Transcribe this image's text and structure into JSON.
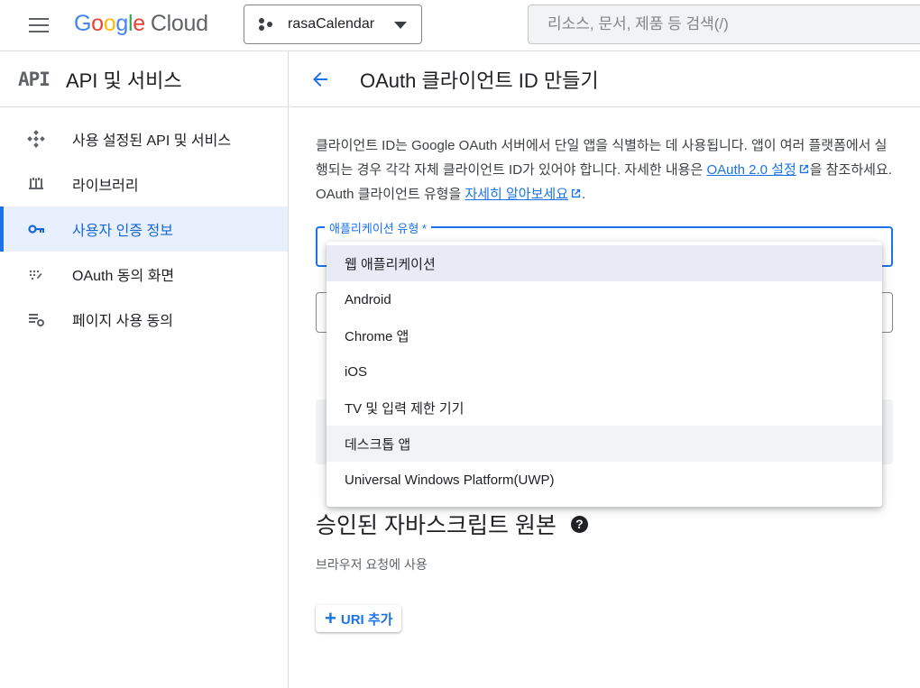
{
  "topbar": {
    "logo_google": [
      "G",
      "o",
      "o",
      "g",
      "l",
      "e"
    ],
    "logo_cloud": "Cloud",
    "project_name": "rasaCalendar",
    "search_placeholder": "리소스, 문서, 제품 등 검색(/)"
  },
  "sidebar": {
    "badge": "API",
    "title": "API 및 서비스",
    "items": [
      {
        "label": "사용 설정된 API 및 서비스",
        "icon": "enabled-apis-icon"
      },
      {
        "label": "라이브러리",
        "icon": "library-icon"
      },
      {
        "label": "사용자 인증 정보",
        "icon": "key-icon",
        "active": true
      },
      {
        "label": "OAuth 동의 화면",
        "icon": "consent-screen-icon"
      },
      {
        "label": "페이지 사용 동의",
        "icon": "page-usage-icon"
      }
    ]
  },
  "main": {
    "title": "OAuth 클라이언트 ID 만들기",
    "desc_part1": "클라이언트 ID는 Google OAuth 서버에서 단일 앱을 식별하는 데 사용됩니다. 앱이 여러 플랫폼에서 실행되는 경우 각각 자체 클라이언트 ID가 있어야 합니다. 자세한 내용은 ",
    "desc_link1": "OAuth 2.0 설정",
    "desc_part2": "을 참조하세요. OAuth 클라이언트 유형을 ",
    "desc_link2": "자세히 알아보세요",
    "desc_part3": ".",
    "app_type_label": "애플리케이션 유형 *",
    "section_title": "승인된 자바스크립트 원본",
    "section_sub": "브라우저 요청에 사용",
    "add_uri_label": "URI 추가"
  },
  "dropdown": {
    "options": [
      "웹 애플리케이션",
      "Android",
      "Chrome 앱",
      "iOS",
      "TV 및 입력 제한 기기",
      "데스크톱 앱",
      "Universal Windows Platform(UWP)"
    ],
    "selected_index": 0,
    "hovered_index": 5
  },
  "colors": {
    "accent": "#1a73e8",
    "active_nav_bg": "#e8f0fe",
    "selected_option_bg": "#e8eaf6"
  }
}
